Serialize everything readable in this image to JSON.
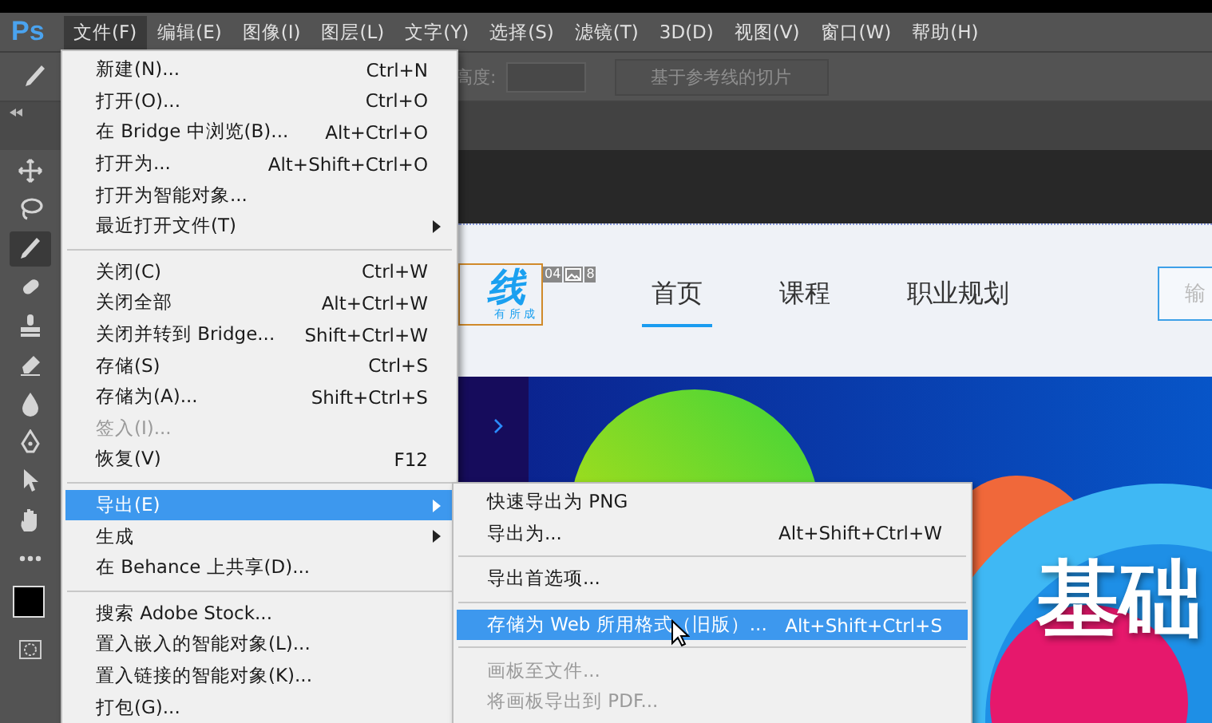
{
  "menubar": {
    "logo": "Ps",
    "menus": [
      {
        "label": "文件(F)",
        "selected": true
      },
      {
        "label": "编辑(E)",
        "selected": false
      },
      {
        "label": "图像(I)",
        "selected": false
      },
      {
        "label": "图层(L)",
        "selected": false
      },
      {
        "label": "文字(Y)",
        "selected": false
      },
      {
        "label": "选择(S)",
        "selected": false
      },
      {
        "label": "滤镜(T)",
        "selected": false
      },
      {
        "label": "3D(D)",
        "selected": false
      },
      {
        "label": "视图(V)",
        "selected": false
      },
      {
        "label": "窗口(W)",
        "selected": false
      },
      {
        "label": "帮助(H)",
        "selected": false
      }
    ]
  },
  "options_bar": {
    "height_label": "高度:",
    "slice_button": "基于参考线的切片"
  },
  "tools": [
    {
      "selected": false
    },
    {
      "selected": false
    },
    {
      "selected": true
    },
    {
      "selected": false
    },
    {
      "selected": false
    },
    {
      "selected": false
    },
    {
      "selected": false
    },
    {
      "selected": false
    },
    {
      "selected": false
    },
    {
      "selected": false
    },
    {
      "selected": false
    }
  ],
  "canvas": {
    "logo": "线",
    "logo_subtitle": "有 所 成",
    "slice_number": "04",
    "slice_count": "8",
    "nav": [
      {
        "label": "首页",
        "selected": true
      },
      {
        "label": "课程",
        "selected": false
      },
      {
        "label": "职业规划",
        "selected": false
      }
    ],
    "search_placeholder": "输",
    "banner_text": "基础"
  },
  "file_menu": {
    "items": [
      {
        "kind": "item",
        "label": "新建(N)...",
        "shortcut": "Ctrl+N",
        "submenu": false,
        "disabled": false,
        "selected": false
      },
      {
        "kind": "item",
        "label": "打开(O)...",
        "shortcut": "Ctrl+O",
        "submenu": false,
        "disabled": false,
        "selected": false
      },
      {
        "kind": "item",
        "label": "在 Bridge 中浏览(B)...",
        "shortcut": "Alt+Ctrl+O",
        "submenu": false,
        "disabled": false,
        "selected": false
      },
      {
        "kind": "item",
        "label": "打开为...",
        "shortcut": "Alt+Shift+Ctrl+O",
        "submenu": false,
        "disabled": false,
        "selected": false
      },
      {
        "kind": "item",
        "label": "打开为智能对象...",
        "submenu": false,
        "disabled": false,
        "selected": false
      },
      {
        "kind": "item",
        "label": "最近打开文件(T)",
        "submenu": true,
        "disabled": false,
        "selected": false
      },
      {
        "kind": "separator"
      },
      {
        "kind": "item",
        "label": "关闭(C)",
        "shortcut": "Ctrl+W",
        "submenu": false,
        "disabled": false,
        "selected": false
      },
      {
        "kind": "item",
        "label": "关闭全部",
        "shortcut": "Alt+Ctrl+W",
        "submenu": false,
        "disabled": false,
        "selected": false
      },
      {
        "kind": "item",
        "label": "关闭并转到 Bridge...",
        "shortcut": "Shift+Ctrl+W",
        "submenu": false,
        "disabled": false,
        "selected": false
      },
      {
        "kind": "item",
        "label": "存储(S)",
        "shortcut": "Ctrl+S",
        "submenu": false,
        "disabled": false,
        "selected": false
      },
      {
        "kind": "item",
        "label": "存储为(A)...",
        "shortcut": "Shift+Ctrl+S",
        "submenu": false,
        "disabled": false,
        "selected": false
      },
      {
        "kind": "item",
        "label": "签入(I)...",
        "submenu": false,
        "disabled": true,
        "selected": false
      },
      {
        "kind": "item",
        "label": "恢复(V)",
        "shortcut": "F12",
        "submenu": false,
        "disabled": false,
        "selected": false
      },
      {
        "kind": "separator"
      },
      {
        "kind": "item",
        "label": "导出(E)",
        "submenu": true,
        "disabled": false,
        "selected": true
      },
      {
        "kind": "item",
        "label": "生成",
        "submenu": true,
        "disabled": false,
        "selected": false
      },
      {
        "kind": "item",
        "label": "在 Behance 上共享(D)...",
        "submenu": false,
        "disabled": false,
        "selected": false
      },
      {
        "kind": "separator"
      },
      {
        "kind": "item",
        "label": "搜索 Adobe Stock...",
        "submenu": false,
        "disabled": false,
        "selected": false
      },
      {
        "kind": "item",
        "label": "置入嵌入的智能对象(L)...",
        "submenu": false,
        "disabled": false,
        "selected": false
      },
      {
        "kind": "item",
        "label": "置入链接的智能对象(K)...",
        "submenu": false,
        "disabled": false,
        "selected": false
      },
      {
        "kind": "item",
        "label": "打包(G)...",
        "submenu": false,
        "disabled": false,
        "selected": false
      }
    ]
  },
  "export_menu": {
    "items": [
      {
        "kind": "item",
        "label": "快速导出为 PNG",
        "disabled": false,
        "selected": false
      },
      {
        "kind": "item",
        "label": "导出为...",
        "shortcut": "Alt+Shift+Ctrl+W",
        "disabled": false,
        "selected": false
      },
      {
        "kind": "separator"
      },
      {
        "kind": "item",
        "label": "导出首选项...",
        "disabled": false,
        "selected": false
      },
      {
        "kind": "separator"
      },
      {
        "kind": "item",
        "label": "存储为 Web 所用格式（旧版）...",
        "shortcut": "Alt+Shift+Ctrl+S",
        "disabled": false,
        "selected": true
      },
      {
        "kind": "separator"
      },
      {
        "kind": "item",
        "label": "画板至文件...",
        "disabled": true,
        "selected": false
      },
      {
        "kind": "item",
        "label": "将画板导出到 PDF...",
        "disabled": true,
        "selected": false
      }
    ]
  }
}
